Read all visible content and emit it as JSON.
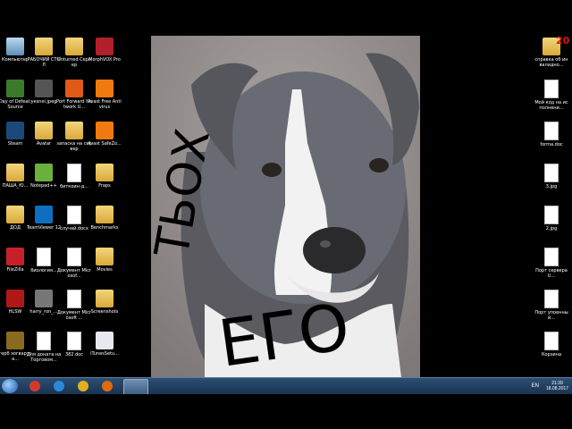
{
  "desktop": {
    "left_icons": [
      {
        "label": "Компьютер",
        "icon": "computer-icon",
        "kind": "sys"
      },
      {
        "label": "РАБОЧИЙ СТОЛ",
        "icon": "folder-icon",
        "kind": "folder"
      },
      {
        "label": "Unturned Сервер",
        "icon": "folder-icon",
        "kind": "folder"
      },
      {
        "label": "MorphVOX Pro",
        "icon": "morphvox-icon",
        "kind": "app",
        "color": "#b0202a"
      },
      {
        "label": "Day of Defeat: Source",
        "icon": "game-icon",
        "kind": "app",
        "color": "#3a7a2a"
      },
      {
        "label": "yesnei.jpeg",
        "icon": "image-file-icon",
        "kind": "app",
        "color": "#555"
      },
      {
        "label": "Port Forward Network U...",
        "icon": "portforward-icon",
        "kind": "app",
        "color": "#e05a16"
      },
      {
        "label": "Avast Free Antivirus",
        "icon": "avast-icon",
        "kind": "app",
        "color": "#f07a10"
      },
      {
        "label": "Steam",
        "icon": "steam-icon",
        "kind": "app",
        "color": "#1b4a7a"
      },
      {
        "label": "Avatar",
        "icon": "folder-icon",
        "kind": "folder"
      },
      {
        "label": "запаска на сервер",
        "icon": "folder-icon",
        "kind": "folder"
      },
      {
        "label": "Avast SafeZo...",
        "icon": "avast-safezone-icon",
        "kind": "app",
        "color": "#f07a10"
      },
      {
        "label": "ПАША_Ю...",
        "icon": "folder-icon",
        "kind": "folder"
      },
      {
        "label": "Notepad++",
        "icon": "notepadpp-icon",
        "kind": "app",
        "color": "#6bb03a"
      },
      {
        "label": "биткоин-д...",
        "icon": "document-icon",
        "kind": "doc"
      },
      {
        "label": "Fraps",
        "icon": "folder-icon",
        "kind": "folder"
      },
      {
        "label": "ДОД",
        "icon": "folder-icon",
        "kind": "folder"
      },
      {
        "label": "TeamViewer 12",
        "icon": "teamviewer-icon",
        "kind": "app",
        "color": "#0e6fc0"
      },
      {
        "label": "случай.docx",
        "icon": "word-doc-icon",
        "kind": "doc"
      },
      {
        "label": "Benchmarks",
        "icon": "folder-icon",
        "kind": "folder"
      },
      {
        "label": "FileZilla",
        "icon": "filezilla-icon",
        "kind": "app",
        "color": "#c8202a"
      },
      {
        "label": "биология...",
        "icon": "word-doc-icon",
        "kind": "doc"
      },
      {
        "label": "Документ Microsof...",
        "icon": "word-doc-icon",
        "kind": "doc"
      },
      {
        "label": "Movies",
        "icon": "folder-icon",
        "kind": "folder"
      },
      {
        "label": "HLSW",
        "icon": "hlsw-icon",
        "kind": "app",
        "color": "#b01818"
      },
      {
        "label": "harry_ron_...",
        "icon": "image-file-icon",
        "kind": "app",
        "color": "#777"
      },
      {
        "label": "Документ Microsoft ...",
        "icon": "word-doc-icon",
        "kind": "doc"
      },
      {
        "label": "Screenshots",
        "icon": "folder-icon",
        "kind": "folder"
      },
      {
        "label": "герб эогвартса...",
        "icon": "image-file-icon",
        "kind": "app",
        "color": "#8a6a20"
      },
      {
        "label": "Для доната на Торговом...",
        "icon": "text-file-icon",
        "kind": "doc"
      },
      {
        "label": "382.doc",
        "icon": "word-doc-icon",
        "kind": "doc"
      },
      {
        "label": "iTunesSetu...",
        "icon": "itunes-icon",
        "kind": "app",
        "color": "#e8e8f0"
      }
    ],
    "right_icons": [
      {
        "label": "справка об инвалидно...",
        "icon": "folder-icon",
        "kind": "folder"
      },
      {
        "label": "Мой код на исполнени...",
        "icon": "document-icon",
        "kind": "doc"
      },
      {
        "label": "forma.doc",
        "icon": "word-doc-icon",
        "kind": "doc"
      },
      {
        "label": "3.jpg",
        "icon": "image-file-icon",
        "kind": "doc"
      },
      {
        "label": "2.jpg",
        "icon": "image-file-icon",
        "kind": "doc"
      },
      {
        "label": "Порт сервера U...",
        "icon": "document-icon",
        "kind": "doc"
      },
      {
        "label": "Порт упоенный...",
        "icon": "document-icon",
        "kind": "doc"
      },
      {
        "label": "Корзина",
        "icon": "recycle-bin-icon",
        "kind": "doc"
      }
    ],
    "corner_badge": "20"
  },
  "photo": {
    "handwriting_top": "ТЬОХ",
    "handwriting_bottom": "ЕГО"
  },
  "taskbar": {
    "buttons": [
      {
        "name": "taskbar-ccleaner",
        "icon": "ccleaner-icon",
        "color": "#d43a2a"
      },
      {
        "name": "taskbar-ie",
        "icon": "internet-explorer-icon",
        "color": "#2a8ad8"
      },
      {
        "name": "taskbar-chrome",
        "icon": "chrome-icon",
        "color": "#e0b020"
      },
      {
        "name": "taskbar-firefox",
        "icon": "firefox-icon",
        "color": "#e06a10"
      },
      {
        "name": "taskbar-paint",
        "icon": "paint-icon",
        "color": "#c8c86a"
      }
    ],
    "language": "EN",
    "time": "21:39",
    "date": "18.08.2017"
  },
  "colors": {
    "taskbar": "#1f3a5a",
    "accent_badge": "#e01010"
  }
}
